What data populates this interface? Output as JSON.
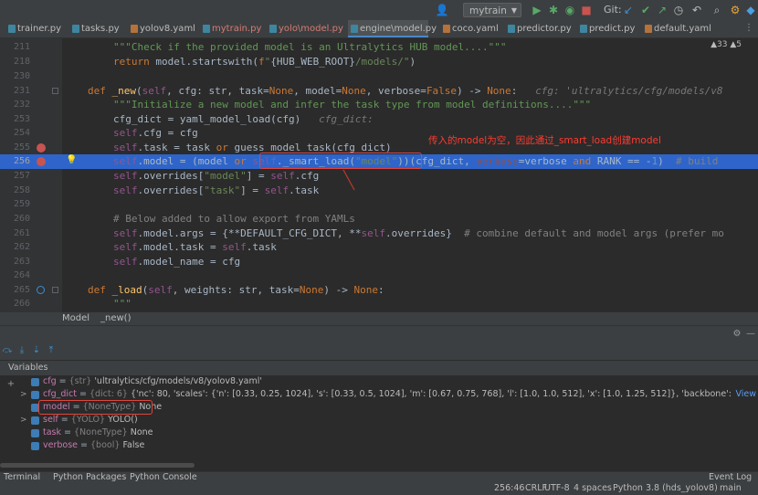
{
  "toolbar": {
    "run_config": "mytrain",
    "git_label": "Git:",
    "icons": [
      "user-icon",
      "run-icon",
      "debug-icon",
      "coverage-icon",
      "stop-icon",
      "update-icon",
      "commit-icon",
      "push-icon",
      "history-icon",
      "rollback-icon",
      "search-icon",
      "settings-icon",
      "logo-icon"
    ]
  },
  "tabs": [
    {
      "label": "trainer.py",
      "type": "py",
      "state": "normal"
    },
    {
      "label": "tasks.py",
      "type": "py",
      "state": "normal"
    },
    {
      "label": "yolov8.yaml",
      "type": "yaml",
      "state": "normal"
    },
    {
      "label": "mytrain.py",
      "type": "py",
      "state": "red"
    },
    {
      "label": "yolo\\model.py",
      "type": "py",
      "state": "red"
    },
    {
      "label": "engine\\model.py",
      "type": "py",
      "state": "active"
    },
    {
      "label": "coco.yaml",
      "type": "yaml",
      "state": "normal"
    },
    {
      "label": "predictor.py",
      "type": "py",
      "state": "normal"
    },
    {
      "label": "predict.py",
      "type": "py",
      "state": "normal"
    },
    {
      "label": "default.yaml",
      "type": "yaml",
      "state": "normal"
    }
  ],
  "editor": {
    "warnings": "▲33  ▲5",
    "lines": [
      {
        "num": "211",
        "text": "    \"\"\"Check if the provided model is an Ultralytics HUB model....\"\"\""
      },
      {
        "num": "218",
        "text": "    return model.startswith(f\"{HUB_WEB_ROOT}/models/\")"
      },
      {
        "num": "230",
        "text": ""
      },
      {
        "num": "231",
        "text": "def _new(self, cfg: str, task=None, model=None, verbose=False) -> None:   cfg: 'ultralytics/cfg/models/v8'"
      },
      {
        "num": "232",
        "text": "    \"\"\"Initialize a new model and infer the task type from model definitions....\"\"\""
      },
      {
        "num": "253",
        "text": "    cfg_dict = yaml_model_load(cfg)   cfg_dict:"
      },
      {
        "num": "254",
        "text": "    self.cfg = cfg"
      },
      {
        "num": "255",
        "text": "    self.task = task or guess_model_task(cfg_dict)"
      },
      {
        "num": "256",
        "text": "    self.model = (model or self._smart_load(\"model\"))(cfg_dict, verbose=verbose and RANK == -1)  # build"
      },
      {
        "num": "257",
        "text": "    self.overrides[\"model\"] = self.cfg"
      },
      {
        "num": "258",
        "text": "    self.overrides[\"task\"] = self.task"
      },
      {
        "num": "259",
        "text": ""
      },
      {
        "num": "260",
        "text": "    # Below added to allow export from YAMLs"
      },
      {
        "num": "261",
        "text": "    self.model.args = {**DEFAULT_CFG_DICT, **self.overrides}  # combine default and model args (prefer mo"
      },
      {
        "num": "262",
        "text": "    self.model.task = self.task"
      },
      {
        "num": "263",
        "text": "    self.model_name = cfg"
      },
      {
        "num": "264",
        "text": ""
      },
      {
        "num": "265",
        "text": "def _load(self, weights: str, task=None) -> None:"
      },
      {
        "num": "266",
        "text": "    \"\"\""
      }
    ],
    "annotation": "传入的model为空，因此通过_smart_load创建model"
  },
  "breadcrumb": {
    "class_name": "Model",
    "method_name": "_new()"
  },
  "variables_panel": {
    "title": "Variables",
    "items": [
      {
        "name": "cfg",
        "type": "{str}",
        "value": "'ultralytics/cfg/models/v8/yolov8.yaml'",
        "expandable": false
      },
      {
        "name": "cfg_dict",
        "type": "{dict: 6}",
        "value": "{'nc': 80, 'scales': {'n': [0.33, 0.25, 1024], 's': [0.33, 0.5, 1024], 'm': [0.67, 0.75, 768], 'l': [1.0, 1.0, 512], 'x': [1.0, 1.25, 512]}, 'backbone': [[-1, 1, 'Conv', [64, 3, 2]], [-1, 1, 'Conv', ...",
        "expandable": true,
        "link": "View"
      },
      {
        "name": "model",
        "type": "{NoneType}",
        "value": "None",
        "expandable": false,
        "highlighted": true
      },
      {
        "name": "self",
        "type": "{YOLO}",
        "value": "YOLO()",
        "expandable": true
      },
      {
        "name": "task",
        "type": "{NoneType}",
        "value": "None",
        "expandable": false
      },
      {
        "name": "verbose",
        "type": "{bool}",
        "value": "False",
        "expandable": false
      }
    ]
  },
  "bottom_tools": {
    "terminal": "Terminal",
    "packages": "Python Packages",
    "console": "Python Console",
    "event_log": "Event Log"
  },
  "status": {
    "position": "256:46",
    "line_sep": "CRLF",
    "encoding": "UTF-8",
    "indent": "4 spaces",
    "interpreter": "Python 3.8 (hds_yolov8)",
    "branch": "main"
  },
  "colors": {
    "accent": "#2f65ca",
    "breakpoint": "#c75450",
    "annotation": "#e0443c"
  }
}
